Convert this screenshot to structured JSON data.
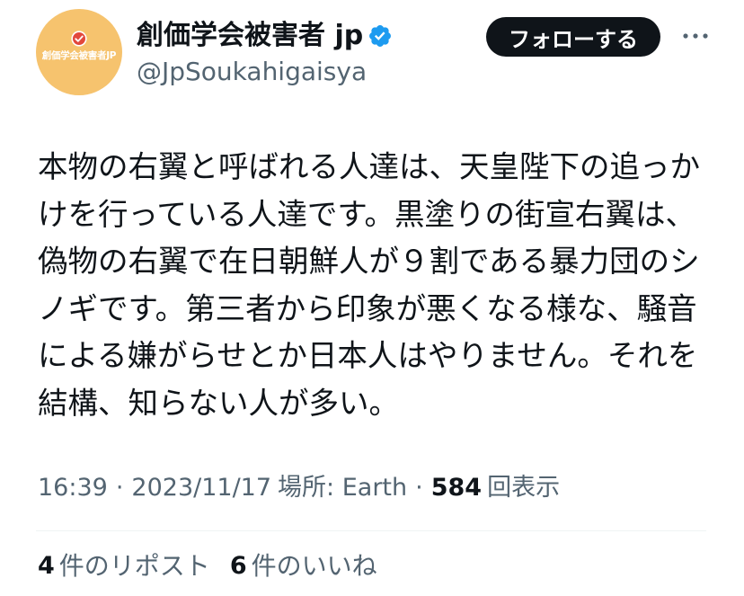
{
  "avatar": {
    "logo_text": "創価学会被害者JP",
    "mark_icon": "check-circle-icon"
  },
  "header": {
    "display_name": "創価学会被害者 jp",
    "verified_icon": "verified-badge-icon",
    "handle": "@JpSoukahigaisya",
    "follow_label": "フォローする",
    "more_icon": "more-dots-icon"
  },
  "tweet": {
    "lines": [
      "本物の右翼と呼ばれる人達は、天皇陛下の追っか",
      "けを行っている人達です。黒塗りの街宣右翼は、",
      "偽物の右翼で在日朝鮮人が９割である暴力団のシ",
      "ノギです。第三者から印象が悪くなる様な、騒音",
      "による嫌がらせとか日本人はやりません。それを",
      "結構、知らない人が多い。"
    ]
  },
  "meta": {
    "time": "16:39",
    "separator": "·",
    "date": "2023/11/17",
    "location": "場所: Earth",
    "views_count": "584",
    "views_label": "回表示"
  },
  "stats": {
    "reposts_count": "4",
    "reposts_label": "件のリポスト",
    "likes_count": "6",
    "likes_label": "件のいいね"
  },
  "colors": {
    "background": "#FFFFFF",
    "text_primary": "#0F1419",
    "text_secondary": "#536471",
    "verified_blue": "#1D9BF0",
    "follow_button_bg": "#0F1419",
    "follow_button_text": "#FFFFFF",
    "avatar_bg": "#F6C36E",
    "avatar_mark_red": "#E2483C",
    "divider": "#EFF3F4"
  }
}
